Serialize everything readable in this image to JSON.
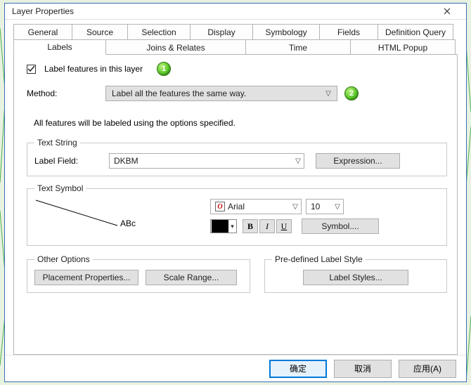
{
  "window": {
    "title": "Layer Properties"
  },
  "tabs_row1": [
    "General",
    "Source",
    "Selection",
    "Display",
    "Symbology",
    "Fields",
    "Definition Query"
  ],
  "tabs_row2": [
    "Labels",
    "Joins & Relates",
    "Time",
    "HTML Popup"
  ],
  "tabs_row1_widths": [
    84,
    80,
    90,
    90,
    96,
    84,
    108
  ],
  "tabs_row2_widths": [
    132,
    200,
    150,
    150
  ],
  "active_tab": "Labels",
  "labels_panel": {
    "checkbox_label": "Label features in this layer",
    "checkbox_checked": true,
    "badge1": "1",
    "method_label": "Method:",
    "method_value": "Label all the features the same way.",
    "badge2": "2",
    "description": "All features will be labeled using the options specified.",
    "text_string": {
      "legend": "Text String",
      "field_label": "Label Field:",
      "field_value": "DKBM",
      "expression_btn": "Expression..."
    },
    "text_symbol": {
      "legend": "Text Symbol",
      "sample": "ABc",
      "font_name": "Arial",
      "font_size": "10",
      "font_icon_glyph": "O",
      "bold": "B",
      "italic": "I",
      "underline": "U",
      "symbol_btn": "Symbol...."
    },
    "other_options": {
      "legend": "Other Options",
      "placement_btn": "Placement Properties...",
      "scale_btn": "Scale Range..."
    },
    "predefined": {
      "legend": "Pre-defined Label Style",
      "styles_btn": "Label Styles..."
    }
  },
  "footer": {
    "ok": "确定",
    "cancel": "取消",
    "apply": "应用(A)"
  }
}
